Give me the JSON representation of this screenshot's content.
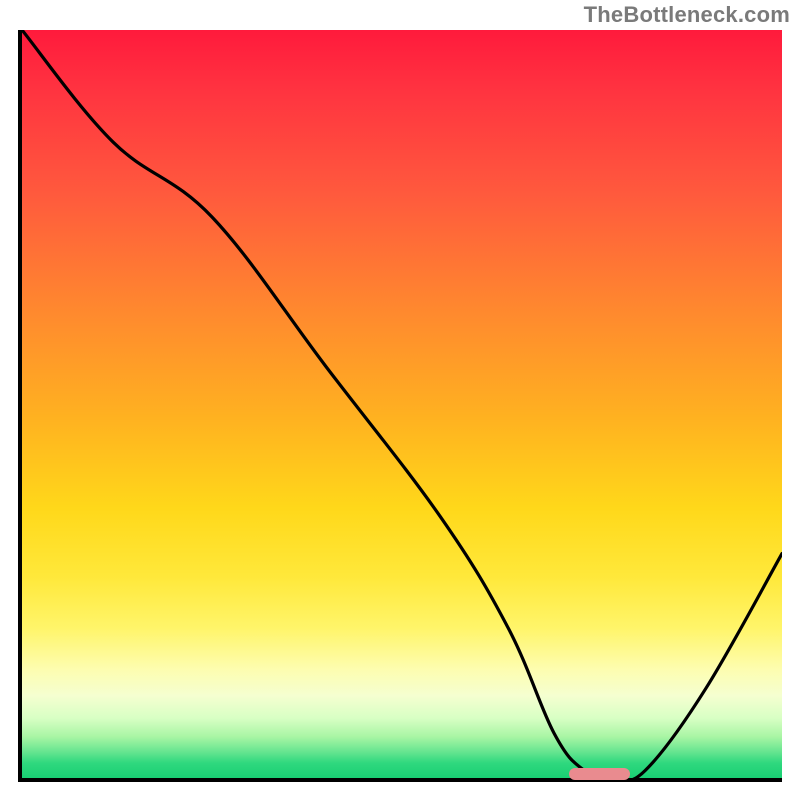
{
  "watermark": "TheBottleneck.com",
  "chart_data": {
    "type": "line",
    "title": "",
    "xlabel": "",
    "ylabel": "",
    "xlim": [
      0,
      100
    ],
    "ylim": [
      0,
      100
    ],
    "grid": false,
    "legend": false,
    "gradient_axis": "y",
    "gradient_meaning": "bottleneck percentage (red≈100%, green≈0%)",
    "series": [
      {
        "name": "bottleneck-curve",
        "x": [
          0,
          12,
          25,
          40,
          55,
          64,
          70,
          74,
          78,
          82,
          90,
          100
        ],
        "values": [
          100,
          85,
          75,
          55,
          35,
          20,
          6,
          1,
          0,
          1,
          12,
          30
        ]
      }
    ],
    "marker": {
      "name": "optimal-range",
      "x_start": 72,
      "x_end": 80,
      "y": 0
    },
    "colors": {
      "top": "#ff1a3c",
      "mid": "#ffd81a",
      "bottom": "#19cf73",
      "curve": "#000000",
      "marker": "#e98b8f"
    }
  }
}
